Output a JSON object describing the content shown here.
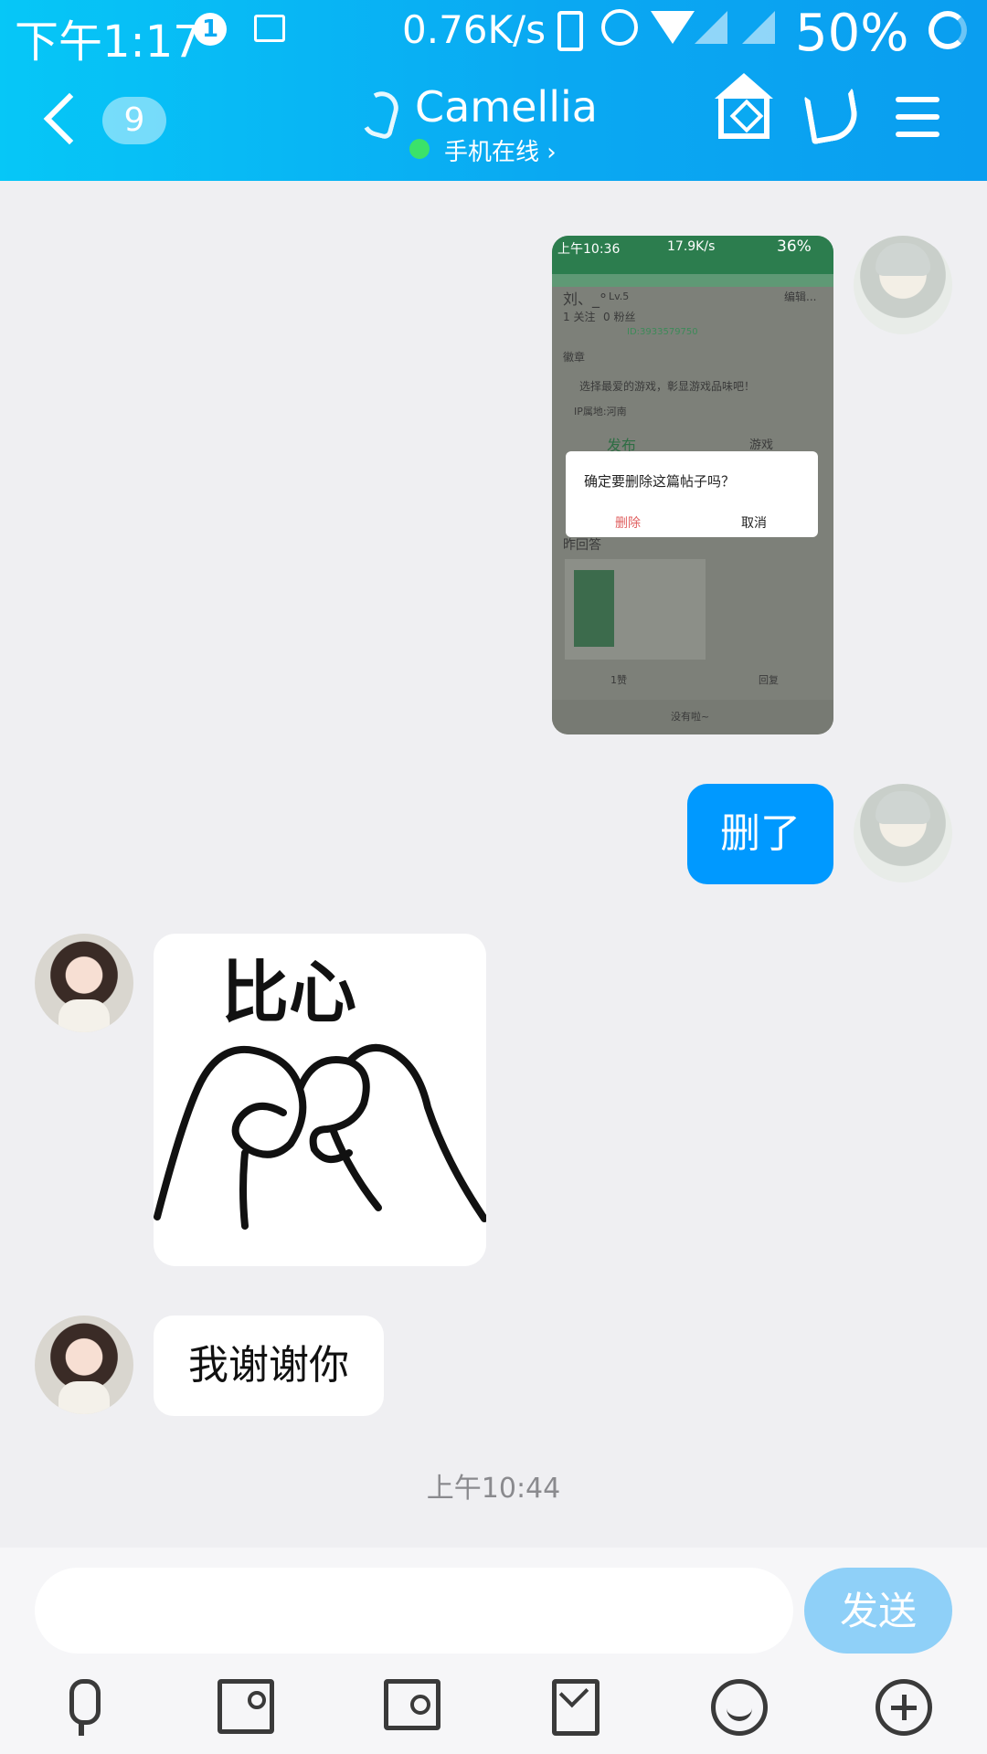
{
  "status_bar": {
    "time": "下午1:17",
    "notification_count": "1",
    "net_speed": "0.76K/s",
    "battery": "50%"
  },
  "header": {
    "unread_count": "9",
    "contact_name": "Camellia",
    "presence": "手机在线 ›"
  },
  "messages": [
    {
      "sender": "me",
      "type": "image",
      "screenshot": {
        "time": "上午10:36",
        "net_speed": "17.9K/s",
        "battery": "36%",
        "profile_name": "刘、_°",
        "level": "Lv.5",
        "edit": "编辑...",
        "follow": "1 关注",
        "fans": "0 粉丝",
        "user_id": "ID:3933579750",
        "badges": "徽章",
        "hint": "选择最爱的游戏，彰显游戏品味吧！",
        "ip_location": "IP属地:河南",
        "tab_publish": "发布",
        "tab_game": "游戏",
        "dialog_question": "确定要删除这篇帖子吗？",
        "dialog_delete": "删除",
        "dialog_cancel": "取消",
        "section": "昨回答",
        "likes": "1赞",
        "reply": "回复",
        "no_more": "没有啦~"
      }
    },
    {
      "sender": "me",
      "type": "text",
      "text": "删了"
    },
    {
      "sender": "her",
      "type": "sticker",
      "text": "比心"
    },
    {
      "sender": "her",
      "type": "text",
      "text": "我谢谢你"
    }
  ],
  "timestamp": "上午10:44",
  "composer": {
    "placeholder": "",
    "send_label": "发送"
  },
  "colors": {
    "header_start": "#06c7f7",
    "header_end": "#0a9ef0",
    "my_bubble": "#0099ff",
    "send_button": "#8fd0f8"
  },
  "icons": [
    "back-icon",
    "ear-icon",
    "home-icon",
    "phone-icon",
    "menu-icon",
    "mic-icon",
    "image-icon",
    "camera-icon",
    "red-packet-icon",
    "emoji-icon",
    "plus-icon"
  ]
}
